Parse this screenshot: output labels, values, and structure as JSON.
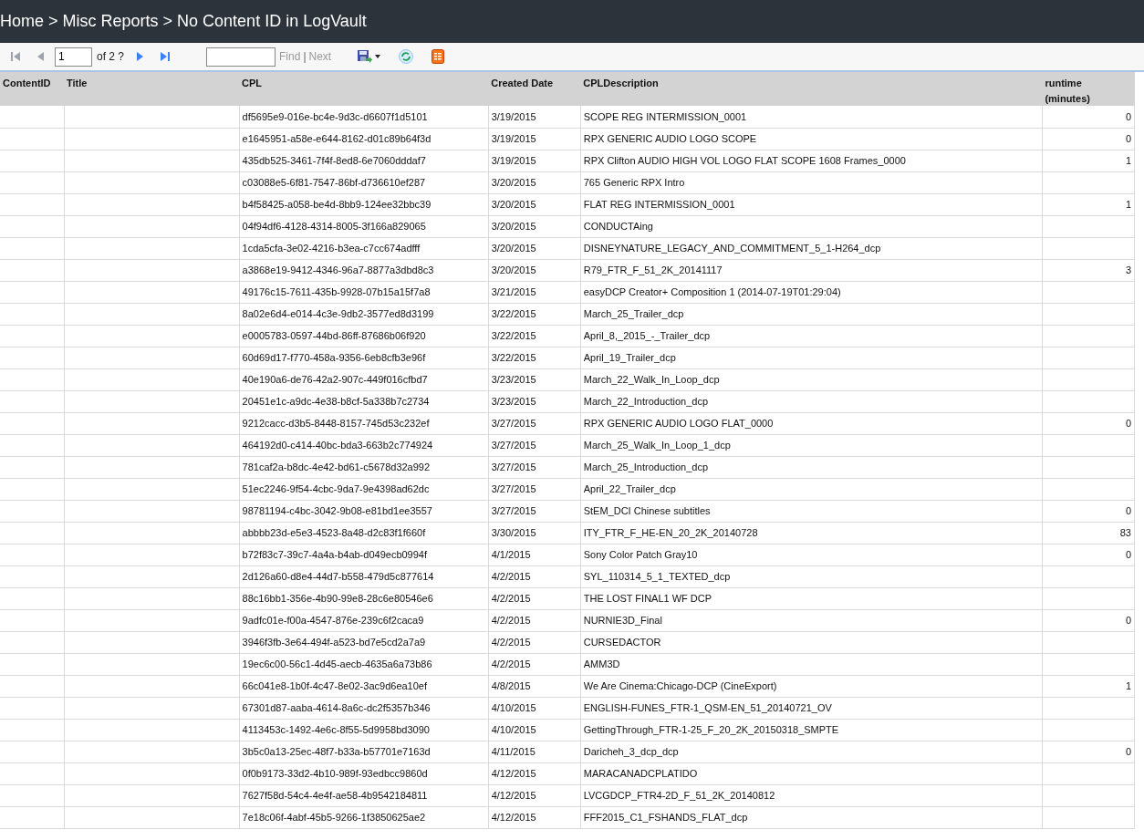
{
  "breadcrumb": {
    "separator": ">",
    "items": [
      "Home",
      "Misc Reports",
      "No Content ID in LogVault"
    ]
  },
  "toolbar": {
    "nav": [
      {
        "kind": "first",
        "disabled": true
      },
      {
        "kind": "prev",
        "disabled": true
      }
    ],
    "page": {
      "value": "1"
    },
    "page_count": "of 2 ?",
    "nav_after": [
      {
        "kind": "next",
        "disabled": false
      },
      {
        "kind": "last",
        "disabled": false
      }
    ],
    "find": {
      "label": "Find",
      "disabled": true
    },
    "find_separator": "|",
    "next": {
      "label": "Next",
      "disabled": true
    }
  },
  "table": {
    "columns": [
      "ContentID",
      "Title",
      "CPL",
      "Created Date",
      "CPLDescription",
      "runtime (minutes)"
    ],
    "rows": [
      {
        "cpl": "df5695e9-016e-bc4e-9d3c-d6607f1d5101",
        "date": "3/19/2015",
        "description": "SCOPE REG INTERMISSION_0001",
        "runtime": "0"
      },
      {
        "cpl": "e1645951-a58e-e644-8162-d01c89b64f3d",
        "date": "3/19/2015",
        "description": "RPX GENERIC AUDIO LOGO SCOPE",
        "runtime": "0"
      },
      {
        "cpl": "435db525-3461-7f4f-8ed8-6e7060dddaf7",
        "date": "3/19/2015",
        "description": "RPX Clifton AUDIO HIGH VOL LOGO FLAT SCOPE 1608 Frames_0000",
        "runtime": "1"
      },
      {
        "cpl": "c03088e5-6f81-7547-86bf-d736610ef287",
        "date": "3/20/2015",
        "description": "765 Generic RPX Intro"
      },
      {
        "cpl": "b4f58425-a058-be4d-8bb9-124ee32bbc39",
        "date": "3/20/2015",
        "description": "FLAT REG INTERMISSION_0001",
        "runtime": "1"
      },
      {
        "cpl": "04f94df6-4128-4314-8005-3f166a829065",
        "date": "3/20/2015",
        "description": "CONDUCTAing"
      },
      {
        "cpl": "1cda5cfa-3e02-4216-b3ea-c7cc674adfff",
        "date": "3/20/2015",
        "description": "DISNEYNATURE_LEGACY_AND_COMMITMENT_5_1-H264_dcp"
      },
      {
        "cpl": "a3868e19-9412-4346-96a7-8877a3dbd8c3",
        "date": "3/20/2015",
        "description": "R79_FTR_F_51_2K_20141117",
        "runtime": "3"
      },
      {
        "cpl": "49176c15-7611-435b-9928-07b15a15f7a8",
        "date": "3/21/2015",
        "description": "easyDCP Creator+ Composition 1 (2014-07-19T01:29:04)"
      },
      {
        "cpl": "8a02e6d4-e014-4c3e-9db2-3577ed8d3199",
        "date": "3/22/2015",
        "description": "March_25_Trailer_dcp"
      },
      {
        "cpl": "e0005783-0597-44bd-86ff-87686b06f920",
        "date": "3/22/2015",
        "description": "April_8,_2015_-_Trailer_dcp"
      },
      {
        "cpl": "60d69d17-f770-458a-9356-6eb8cfb3e96f",
        "date": "3/22/2015",
        "description": "April_19_Trailer_dcp"
      },
      {
        "cpl": "40e190a6-de76-42a2-907c-449f016cfbd7",
        "date": "3/23/2015",
        "description": "March_22_Walk_In_Loop_dcp"
      },
      {
        "cpl": "20451e1c-a9dc-4e38-b8cf-5a338b7c2734",
        "date": "3/23/2015",
        "description": "March_22_Introduction_dcp"
      },
      {
        "cpl": "9212cacc-d3b5-8448-8157-745d53c232ef",
        "date": "3/27/2015",
        "description": "RPX GENERIC AUDIO LOGO FLAT_0000",
        "runtime": "0"
      },
      {
        "cpl": "464192d0-c414-40bc-bda3-663b2c774924",
        "date": "3/27/2015",
        "description": "March_25_Walk_In_Loop_1_dcp"
      },
      {
        "cpl": "781caf2a-b8dc-4e42-bd61-c5678d32a992",
        "date": "3/27/2015",
        "description": "March_25_Introduction_dcp"
      },
      {
        "cpl": "51ec2246-9f54-4cbc-9da7-9e4398ad62dc",
        "date": "3/27/2015",
        "description": "April_22_Trailer_dcp"
      },
      {
        "cpl": "98781194-c4bc-3042-9b08-e81bd1ee3557",
        "date": "3/27/2015",
        "description": "StEM_DCI Chinese subtitles",
        "runtime": "0"
      },
      {
        "cpl": "abbbb23d-e5e3-4523-8a48-d2c83f1f660f",
        "date": "3/30/2015",
        "description": "ITY_FTR_F_HE-EN_20_2K_20140728",
        "runtime": "83"
      },
      {
        "cpl": "b72f83c7-39c7-4a4a-b4ab-d049ecb0994f",
        "date": "4/1/2015",
        "description": "Sony Color Patch Gray10",
        "runtime": "0"
      },
      {
        "cpl": "2d126a60-d8e4-44d7-b558-479d5c877614",
        "date": "4/2/2015",
        "description": "SYL_110314_5_1_TEXTED_dcp"
      },
      {
        "cpl": "88c16bb1-356e-4b90-99e8-28c6e80546e6",
        "date": "4/2/2015",
        "description": "THE LOST FINAL1 WF DCP"
      },
      {
        "cpl": "9adfc01e-f00a-4547-876e-239c6f2caca9",
        "date": "4/2/2015",
        "description": "NURNIE3D_Final",
        "runtime": "0"
      },
      {
        "cpl": "3946f3fb-3e64-494f-a523-bd7e5cd2a7a9",
        "date": "4/2/2015",
        "description": "CURSEDACTOR"
      },
      {
        "cpl": "19ec6c00-56c1-4d45-aecb-4635a6a73b86",
        "date": "4/2/2015",
        "description": "AMM3D"
      },
      {
        "cpl": "66c041e8-1b0f-4c47-8e02-3ac9d6ea10ef",
        "date": "4/8/2015",
        "description": "We Are Cinema:Chicago-DCP (CineExport)",
        "runtime": "1"
      },
      {
        "cpl": "67301d87-aaba-4614-8a6c-dc2f5357b346",
        "date": "4/10/2015",
        "description": "ENGLISH-FUNES_FTR-1_QSM-EN_51_20140721_OV"
      },
      {
        "cpl": "4113453c-1492-4e6c-8f55-5d9958bd3090",
        "date": "4/10/2015",
        "description": "GettingThrough_FTR-1-25_F_20_2K_20150318_SMPTE"
      },
      {
        "cpl": "3b5c0a13-25ec-48f7-b33a-b57701e7163d",
        "date": "4/11/2015",
        "description": "Daricheh_3_dcp_dcp",
        "runtime": "0"
      },
      {
        "cpl": "0f0b9173-33d2-4b10-989f-93edbcc9860d",
        "date": "4/12/2015",
        "description": "MARACANADCPLATIDO"
      },
      {
        "cpl": "7627f58d-54c4-4e4f-ae58-4b9542184811",
        "date": "4/12/2015",
        "description": "LVCGDCP_FTR4-2D_F_51_2K_20140812"
      },
      {
        "cpl": "7e18c06f-4abf-45b5-9266-1f3850625ae2",
        "date": "4/12/2015",
        "description": "FFF2015_C1_FSHANDS_FLAT_dcp"
      }
    ]
  }
}
